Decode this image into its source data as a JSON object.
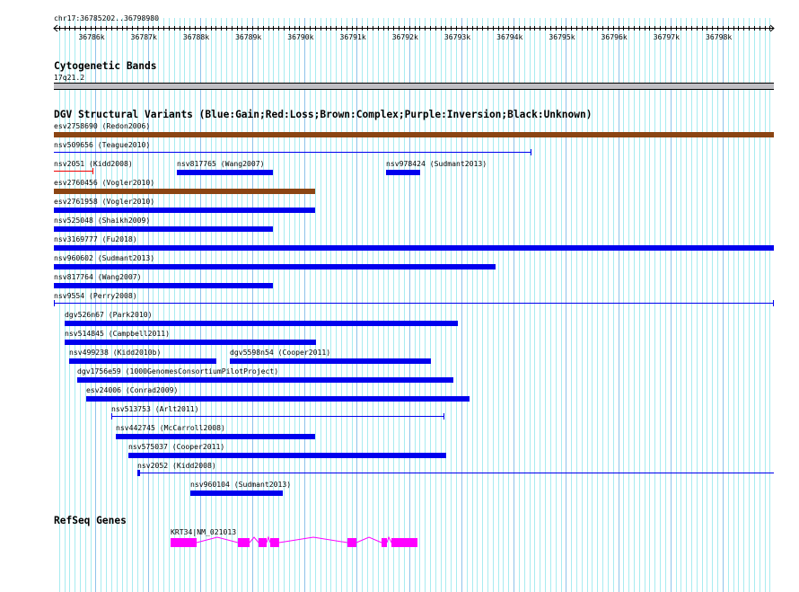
{
  "ruler": {
    "location": "chr17:36785202..36798980",
    "start": 36785202,
    "end": 36798980,
    "tick_labels": [
      "36786k",
      "36787k",
      "36788k",
      "36789k",
      "36790k",
      "36791k",
      "36792k",
      "36793k",
      "36794k",
      "36795k",
      "36796k",
      "36797k",
      "36798k"
    ]
  },
  "cytoband": {
    "title": "Cytogenetic Bands",
    "band": "17q21.2"
  },
  "dgv": {
    "title": "DGV Structural Variants (Blue:Gain;Red:Loss;Brown:Complex;Purple:Inversion;Black:Unknown)",
    "colors": {
      "gain": "#0000ee",
      "loss": "#ee0000",
      "complex": "#8b4513",
      "inversion": "#800080",
      "unknown": "#000000"
    },
    "variants": [
      {
        "label": "esv2758690 (Redon2006)",
        "type": "complex"
      },
      {
        "label": "nsv509656 (Teague2010)",
        "type": "gain"
      },
      {
        "label": "nsv2051 (Kidd2008)",
        "type": "loss"
      },
      {
        "label": "nsv817765 (Wang2007)",
        "type": "gain"
      },
      {
        "label": "nsv978424 (Sudmant2013)",
        "type": "gain"
      },
      {
        "label": "esv2760456 (Vogler2010)",
        "type": "complex"
      },
      {
        "label": "esv2761958 (Vogler2010)",
        "type": "gain"
      },
      {
        "label": "nsv525048 (Shaikh2009)",
        "type": "gain"
      },
      {
        "label": "nsv3169777 (Fu2018)",
        "type": "gain"
      },
      {
        "label": "nsv960602 (Sudmant2013)",
        "type": "gain"
      },
      {
        "label": "nsv817764 (Wang2007)",
        "type": "gain"
      },
      {
        "label": "nsv9554 (Perry2008)",
        "type": "gain"
      },
      {
        "label": "dgv526n67 (Park2010)",
        "type": "gain"
      },
      {
        "label": "nsv514845 (Campbell2011)",
        "type": "gain"
      },
      {
        "label": "nsv499238 (Kidd2010b)",
        "type": "gain"
      },
      {
        "label": "dgv5598n54 (Cooper2011)",
        "type": "gain"
      },
      {
        "label": "dgv1756e59 (1000GenomesConsortiumPilotProject)",
        "type": "gain"
      },
      {
        "label": "esv24006 (Conrad2009)",
        "type": "gain"
      },
      {
        "label": "nsv513753 (Arlt2011)",
        "type": "gain"
      },
      {
        "label": "nsv442745 (McCarroll2008)",
        "type": "gain"
      },
      {
        "label": "nsv575037 (Cooper2011)",
        "type": "gain"
      },
      {
        "label": "nsv2052 (Kidd2008)",
        "type": "gain"
      },
      {
        "label": "nsv960104 (Sudmant2013)",
        "type": "gain"
      }
    ]
  },
  "refseq": {
    "title": "RefSeq Genes",
    "gene_label": "KRT34|NM_021013",
    "color": "#ff00ff"
  }
}
